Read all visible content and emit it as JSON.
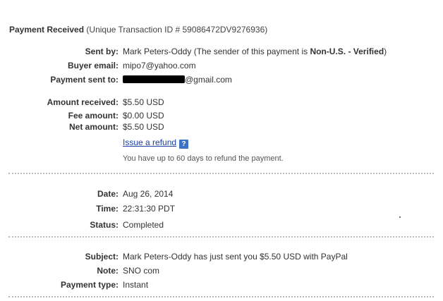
{
  "header": {
    "title_bold": "Payment Received",
    "title_rest": "(Unique Transaction ID # 59086472DV9276936)"
  },
  "sender": {
    "sent_by_label": "Sent by:",
    "sent_by_name": "Mark Peters-Oddy",
    "sent_by_prefix": "(The sender of this payment is",
    "sent_by_status": "Non-U.S. - Verified",
    "sent_by_suffix": ")",
    "buyer_email_label": "Buyer email:",
    "buyer_email": "mipo7@yahoo.com",
    "payment_sent_to_label": "Payment sent to:",
    "payment_sent_to_visible": "@gmail.com"
  },
  "amounts": {
    "amount_received_label": "Amount received:",
    "amount_received": "$5.50 USD",
    "fee_amount_label": "Fee amount:",
    "fee_amount": "$0.00 USD",
    "net_amount_label": "Net amount:",
    "net_amount": "$5.50 USD",
    "refund_link": "Issue a refund",
    "help_icon": "?",
    "refund_note": "You have up to 60 days to refund the payment."
  },
  "timing": {
    "date_label": "Date:",
    "date": "Aug 26, 2014",
    "time_label": "Time:",
    "time": "22:31:30 PDT",
    "status_label": "Status:",
    "status": "Completed"
  },
  "details": {
    "subject_label": "Subject:",
    "subject": "Mark Peters-Oddy has just sent you $5.50 USD with PayPal",
    "note_label": "Note:",
    "note": "SNO com",
    "payment_type_label": "Payment type:",
    "payment_type": "Instant"
  },
  "colors": {
    "link": "#1b3fa3",
    "help_icon_bg": "#3d73c4",
    "separator": "#b8b8b8"
  },
  "icons": {
    "help": "help-question-icon"
  }
}
